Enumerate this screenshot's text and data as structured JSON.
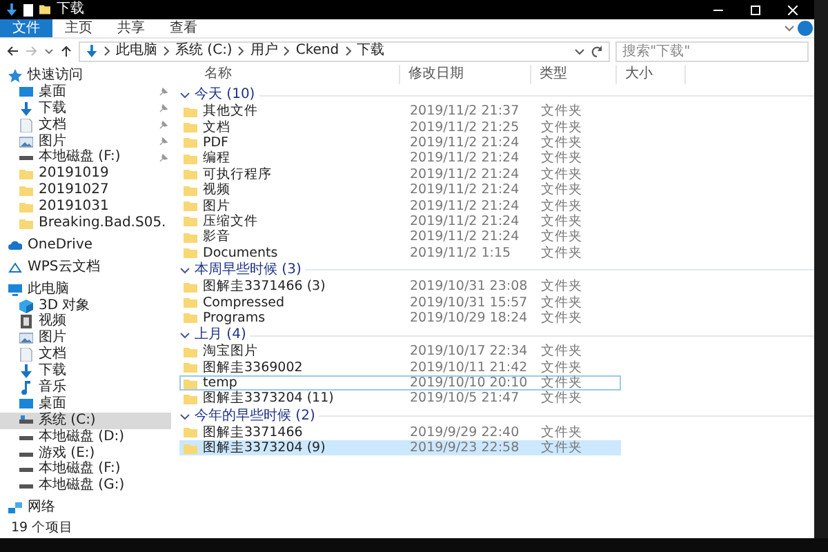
{
  "window": {
    "title": "下载"
  },
  "ribbon_tabs": [
    {
      "label": "文件",
      "selected": true
    },
    {
      "label": "主页",
      "selected": false
    },
    {
      "label": "共享",
      "selected": false
    },
    {
      "label": "查看",
      "selected": false
    }
  ],
  "address_bar": {
    "path": [
      "此电脑",
      "系统 (C:)",
      "用户",
      "Ckend",
      "下载"
    ]
  },
  "search": {
    "placeholder": "搜索\"下载\""
  },
  "sidebar": {
    "items": [
      {
        "label": "快速访问",
        "kind": "star",
        "pinned": false,
        "selected": false,
        "children": [
          {
            "label": "桌面",
            "kind": "desktop",
            "pinned": true,
            "selected": false
          },
          {
            "label": "下载",
            "kind": "download",
            "pinned": true,
            "selected": false
          },
          {
            "label": "文档",
            "kind": "document",
            "pinned": true,
            "selected": false
          },
          {
            "label": "图片",
            "kind": "picture",
            "pinned": true,
            "selected": false
          },
          {
            "label": "本地磁盘 (F:)",
            "kind": "drive",
            "pinned": true,
            "selected": false
          },
          {
            "label": "20191019",
            "kind": "folder",
            "pinned": false,
            "selected": false
          },
          {
            "label": "20191027",
            "kind": "folder",
            "pinned": false,
            "selected": false
          },
          {
            "label": "20191031",
            "kind": "folder",
            "pinned": false,
            "selected": false
          },
          {
            "label": "Breaking.Bad.S05.",
            "kind": "folder",
            "pinned": false,
            "selected": false
          }
        ]
      },
      {
        "label": "OneDrive",
        "kind": "cloud",
        "pinned": false,
        "selected": false
      },
      {
        "label": "WPS云文档",
        "kind": "wps",
        "pinned": false,
        "selected": false
      },
      {
        "label": "此电脑",
        "kind": "pc",
        "pinned": false,
        "selected": false,
        "children": [
          {
            "label": "3D 对象",
            "kind": "cube",
            "pinned": false,
            "selected": false
          },
          {
            "label": "视频",
            "kind": "video",
            "pinned": false,
            "selected": false
          },
          {
            "label": "图片",
            "kind": "picture",
            "pinned": false,
            "selected": false
          },
          {
            "label": "文档",
            "kind": "document",
            "pinned": false,
            "selected": false
          },
          {
            "label": "下载",
            "kind": "download",
            "pinned": false,
            "selected": false
          },
          {
            "label": "音乐",
            "kind": "music",
            "pinned": false,
            "selected": false
          },
          {
            "label": "桌面",
            "kind": "desktop",
            "pinned": false,
            "selected": false
          },
          {
            "label": "系统 (C:)",
            "kind": "sysdrive",
            "pinned": false,
            "selected": true
          },
          {
            "label": "本地磁盘 (D:)",
            "kind": "drive",
            "pinned": false,
            "selected": false
          },
          {
            "label": "游戏 (E:)",
            "kind": "drive",
            "pinned": false,
            "selected": false
          },
          {
            "label": "本地磁盘 (F:)",
            "kind": "drive",
            "pinned": false,
            "selected": false
          },
          {
            "label": "本地磁盘 (G:)",
            "kind": "drive",
            "pinned": false,
            "selected": false
          }
        ]
      },
      {
        "label": "网络",
        "kind": "network",
        "pinned": false,
        "selected": false
      }
    ]
  },
  "columns": [
    "名称",
    "修改日期",
    "类型",
    "大小"
  ],
  "groups": [
    {
      "title": "今天 (10)",
      "expanded": true,
      "items": [
        {
          "name": "其他文件",
          "modified": "2019/11/2 21:37",
          "type": "文件夹",
          "selected": false,
          "focused": false
        },
        {
          "name": "文档",
          "modified": "2019/11/2 21:25",
          "type": "文件夹",
          "selected": false,
          "focused": false
        },
        {
          "name": "PDF",
          "modified": "2019/11/2 21:24",
          "type": "文件夹",
          "selected": false,
          "focused": false
        },
        {
          "name": "编程",
          "modified": "2019/11/2 21:24",
          "type": "文件夹",
          "selected": false,
          "focused": false
        },
        {
          "name": "可执行程序",
          "modified": "2019/11/2 21:24",
          "type": "文件夹",
          "selected": false,
          "focused": false
        },
        {
          "name": "视频",
          "modified": "2019/11/2 21:24",
          "type": "文件夹",
          "selected": false,
          "focused": false
        },
        {
          "name": "图片",
          "modified": "2019/11/2 21:24",
          "type": "文件夹",
          "selected": false,
          "focused": false
        },
        {
          "name": "压缩文件",
          "modified": "2019/11/2 21:24",
          "type": "文件夹",
          "selected": false,
          "focused": false
        },
        {
          "name": "影音",
          "modified": "2019/11/2 21:24",
          "type": "文件夹",
          "selected": false,
          "focused": false
        },
        {
          "name": "Documents",
          "modified": "2019/11/2 1:15",
          "type": "文件夹",
          "selected": false,
          "focused": false
        }
      ]
    },
    {
      "title": "本周早些时候 (3)",
      "expanded": true,
      "items": [
        {
          "name": "图解圭3371466 (3)",
          "modified": "2019/10/31 23:08",
          "type": "文件夹",
          "selected": false,
          "focused": false
        },
        {
          "name": "Compressed",
          "modified": "2019/10/31 15:57",
          "type": "文件夹",
          "selected": false,
          "focused": false
        },
        {
          "name": "Programs",
          "modified": "2019/10/29 18:24",
          "type": "文件夹",
          "selected": false,
          "focused": false
        }
      ]
    },
    {
      "title": "上月 (4)",
      "expanded": true,
      "items": [
        {
          "name": "淘宝图片",
          "modified": "2019/10/17 22:34",
          "type": "文件夹",
          "selected": false,
          "focused": false
        },
        {
          "name": "图解圭3369002",
          "modified": "2019/10/11 21:42",
          "type": "文件夹",
          "selected": false,
          "focused": false
        },
        {
          "name": "temp",
          "modified": "2019/10/10 20:10",
          "type": "文件夹",
          "selected": false,
          "focused": true
        },
        {
          "name": "图解圭3373204 (11)",
          "modified": "2019/10/5 21:47",
          "type": "文件夹",
          "selected": false,
          "focused": false
        }
      ]
    },
    {
      "title": "今年的早些时候 (2)",
      "expanded": true,
      "items": [
        {
          "name": "图解圭3371466",
          "modified": "2019/9/29 22:40",
          "type": "文件夹",
          "selected": false,
          "focused": false
        },
        {
          "name": "图解圭3373204 (9)",
          "modified": "2019/9/23 22:58",
          "type": "文件夹",
          "selected": true,
          "focused": false
        }
      ]
    }
  ],
  "status_bar": {
    "text": "19 个项目"
  }
}
